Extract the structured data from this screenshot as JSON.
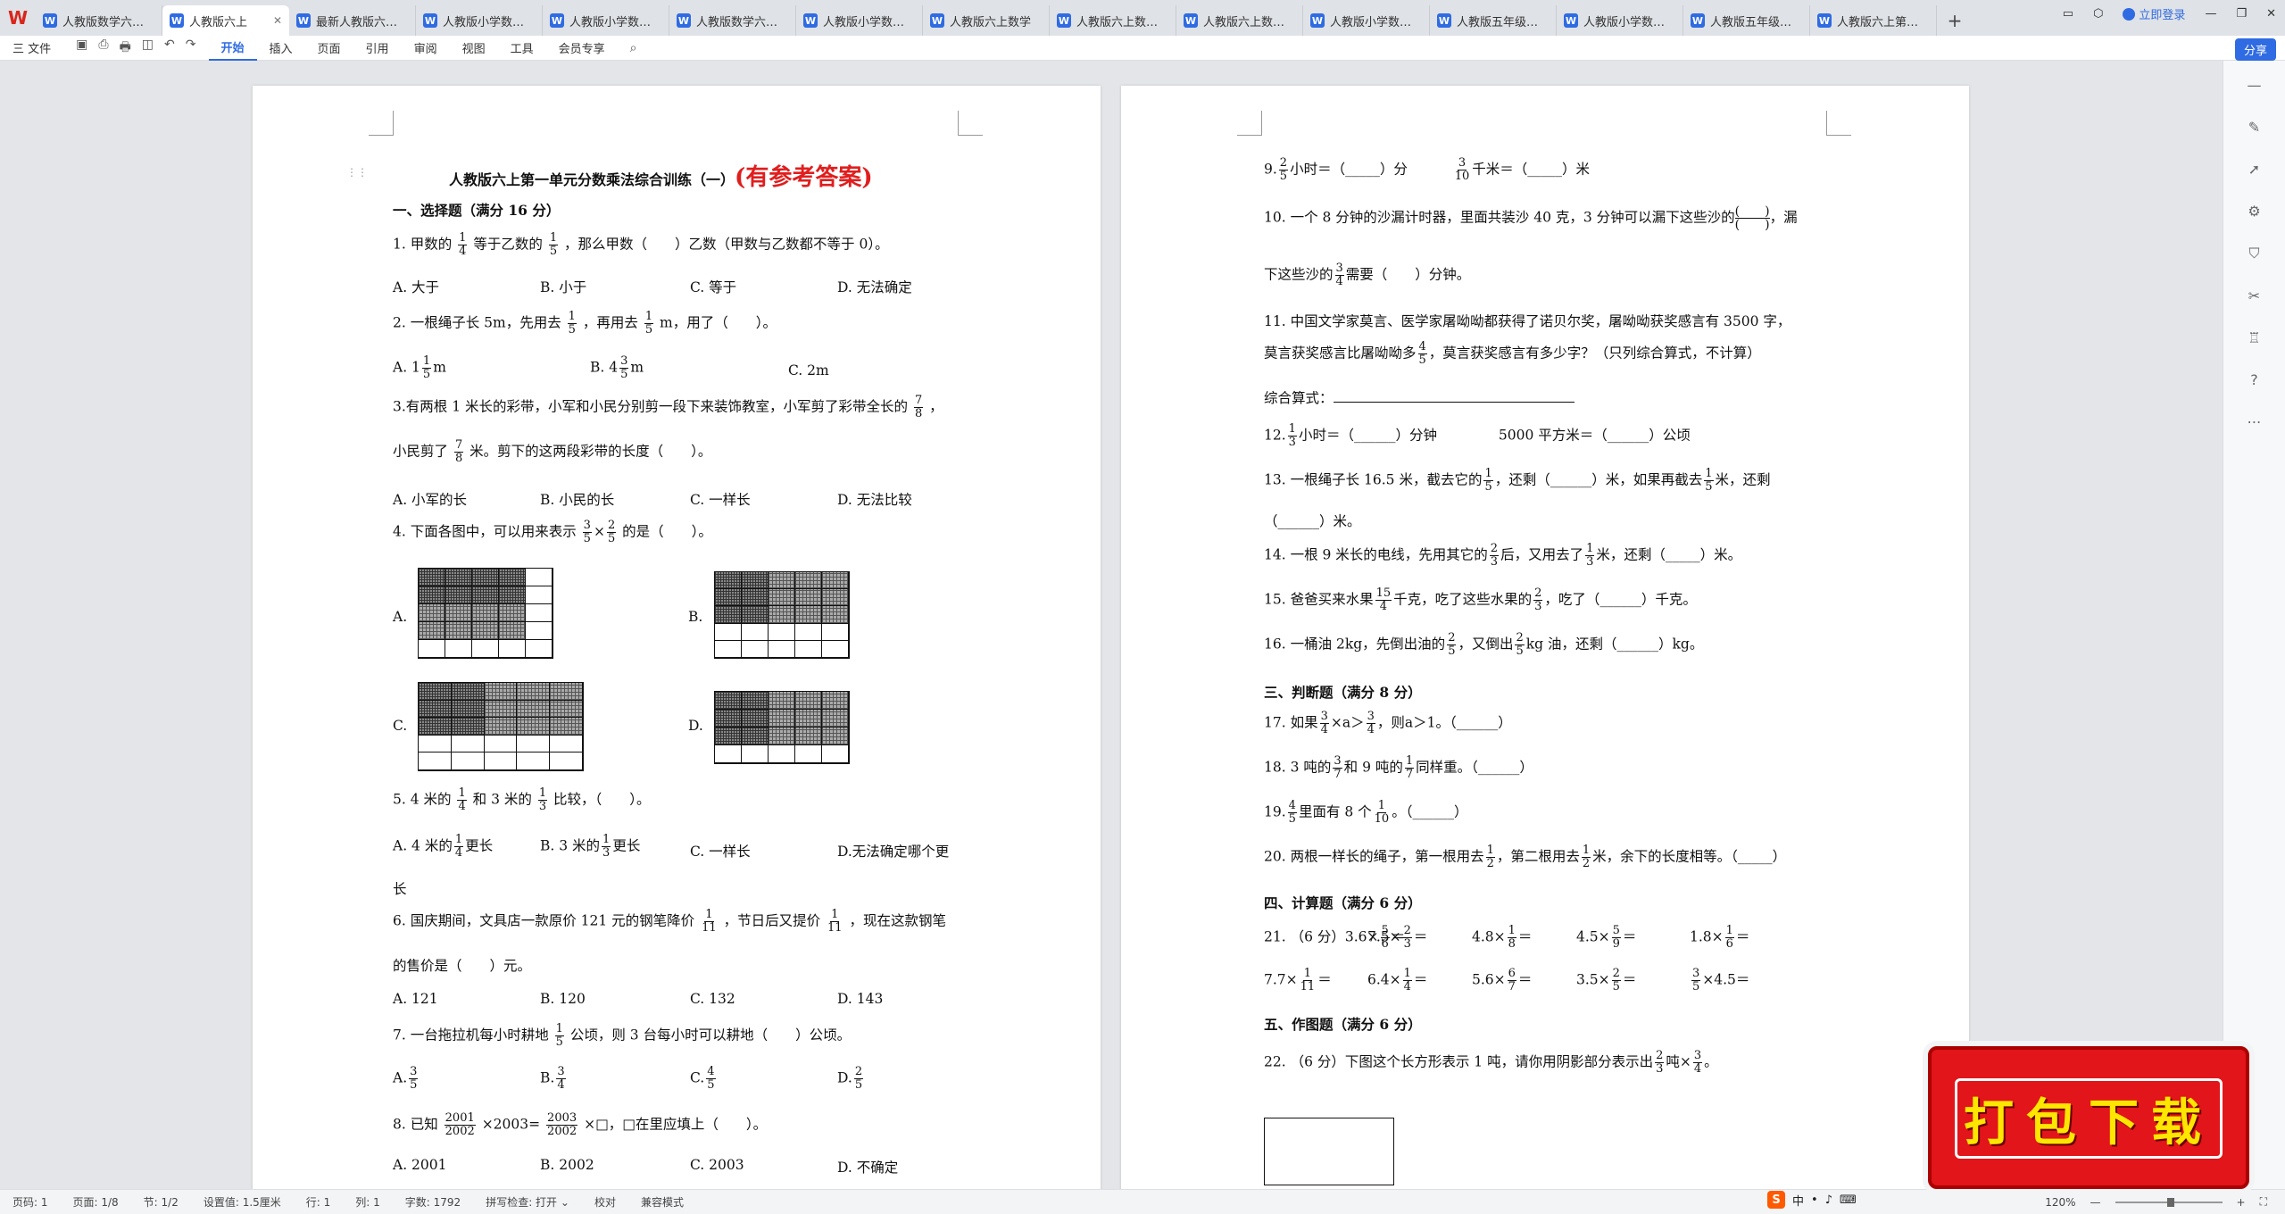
{
  "tabbar": {
    "tabs": [
      {
        "label": "人教版数学六年级"
      },
      {
        "label": "人教版六上",
        "active": true
      },
      {
        "label": "最新人教版六上数"
      },
      {
        "label": "人教版小学数学六"
      },
      {
        "label": "人教版小学数学六"
      },
      {
        "label": "人教版数学六年级"
      },
      {
        "label": "人教版小学数学六"
      },
      {
        "label": "人教版六上数学"
      },
      {
        "label": "人教版六上数学第"
      },
      {
        "label": "人教版六上数学第"
      },
      {
        "label": "人教版小学数学六"
      },
      {
        "label": "人教版五年级上册"
      },
      {
        "label": "人教版小学数学六"
      },
      {
        "label": "人教版五年级上册"
      },
      {
        "label": "人教版六上第一单"
      }
    ],
    "login_label": "立即登录"
  },
  "toolbar": {
    "file_label": "三 文件",
    "items": [
      "开始",
      "插入",
      "页面",
      "引用",
      "审阅",
      "视图",
      "工具",
      "会员专享"
    ],
    "share_label": "分享"
  },
  "page1": {
    "title": "人教版六上第一单元分数乘法综合训练（一）",
    "title_red": "(有参考答案)",
    "sec1": "一、选择题（满分 16 分）",
    "q1_a": "1. 甲数的",
    "q1_f1": {
      "n": "1",
      "d": "4"
    },
    "q1_b": "等于乙数的",
    "q1_f2": {
      "n": "1",
      "d": "5"
    },
    "q1_c": "，那么甲数（　　）乙数（甲数与乙数都不等于 0）。",
    "q1_opts": [
      "A. 大于",
      "B. 小于",
      "C. 等于",
      "D. 无法确定"
    ],
    "q2_a": "2. 一根绳子长 5m，先用去",
    "q2_f1": {
      "n": "1",
      "d": "5"
    },
    "q2_b": "，再用去",
    "q2_f2": {
      "n": "1",
      "d": "5"
    },
    "q2_c": "m，用了（　　）。",
    "q2_opts": [
      {
        "pre": "A. 1",
        "n": "1",
        "d": "5",
        "post": "m"
      },
      {
        "pre": "B. 4",
        "n": "3",
        "d": "5",
        "post": "m"
      },
      {
        "pre": "C. 2m",
        "n": "",
        "d": "",
        "post": ""
      }
    ],
    "q3_a": "3.有两根 1 米长的彩带，小军和小民分别剪一段下来装饰教室，小军剪了彩带全长的",
    "q3_f1": {
      "n": "7",
      "d": "8"
    },
    "q3_b": "，",
    "q3_c": "小民剪了",
    "q3_f2": {
      "n": "7",
      "d": "8"
    },
    "q3_d": "米。剪下的这两段彩带的长度（　　）。",
    "q3_opts": [
      "A. 小军的长",
      "B. 小民的长",
      "C. 一样长",
      "D. 无法比较"
    ],
    "q4_a": "4. 下面各图中，可以用来表示",
    "q4_f1": {
      "n": "3",
      "d": "5"
    },
    "q4_x": "×",
    "q4_f2": {
      "n": "2",
      "d": "5"
    },
    "q4_b": "的是（　　）。",
    "q4_labels": [
      "A.",
      "B.",
      "C.",
      "D."
    ],
    "q5_a": "5. 4 米的",
    "q5_f1": {
      "n": "1",
      "d": "4"
    },
    "q5_b": "和 3 米的",
    "q5_f2": {
      "n": "1",
      "d": "3"
    },
    "q5_c": "比较，（　　）。",
    "q5_optA": "A. 4 米的",
    "q5_optA_f": {
      "n": "1",
      "d": "4"
    },
    "q5_optA_b": "更长",
    "q5_optB": "B. 3 米的",
    "q5_optB_f": {
      "n": "1",
      "d": "3"
    },
    "q5_optB_b": "更长",
    "q5_optC": "C. 一样长",
    "q5_optD": "D.无法确定哪个更",
    "q5_optD2": "长",
    "q6_a": "6. 国庆期间，文具店一款原价 121 元的钢笔降价",
    "q6_f1": {
      "n": "1",
      "d": "11"
    },
    "q6_b": "，节日后又提价",
    "q6_f2": {
      "n": "1",
      "d": "11"
    },
    "q6_c": "，现在这款钢笔",
    "q6_d": "的售价是（　　）元。",
    "q6_opts": [
      "A. 121",
      "B. 120",
      "C. 132",
      "D. 143"
    ],
    "q7_a": "7. 一台拖拉机每小时耕地",
    "q7_f1": {
      "n": "1",
      "d": "5"
    },
    "q7_b": "公顷，则 3 台每小时可以耕地（　　）公顷。",
    "q7_opts": [
      {
        "pre": "A.",
        "n": "3",
        "d": "5"
      },
      {
        "pre": "B.",
        "n": "3",
        "d": "4"
      },
      {
        "pre": "C.",
        "n": "4",
        "d": "5"
      },
      {
        "pre": "D.",
        "n": "2",
        "d": "5"
      }
    ],
    "q8_a": "8. 已知",
    "q8_f1": {
      "n": "2001",
      "d": "2002"
    },
    "q8_b": "×2003=",
    "q8_f2": {
      "n": "2003",
      "d": "2002"
    },
    "q8_c": "×□，□在里应填上（　　）。",
    "q8_opts": [
      "A. 2001",
      "B. 2002",
      "C. 2003",
      "D. 不确定"
    ]
  },
  "page2": {
    "q9_a": "9.",
    "q9_f1": {
      "n": "2",
      "d": "5"
    },
    "q9_b": "小时＝（_____）分",
    "q9_f2": {
      "n": "3",
      "d": "10"
    },
    "q9_c": "千米＝（_____）米",
    "q10_a": "10. 一个 8 分钟的沙漏计时器，里面共装沙 40 克，3 分钟可以漏下这些沙的",
    "q10_p": {
      "n": "(　　)",
      "d": "(　　)"
    },
    "q10_b": "，漏",
    "q10_c": "下这些沙的",
    "q10_f": {
      "n": "3",
      "d": "4"
    },
    "q10_d": "需要（　　）分钟。",
    "q11_a": "11. 中国文学家莫言、医学家屠呦呦都获得了诺贝尔奖，屠呦呦获奖感言有 3500 字，",
    "q11_b": "莫言获奖感言比屠呦呦多",
    "q11_f": {
      "n": "4",
      "d": "5"
    },
    "q11_c": "，莫言获奖感言有多少字？（只列综合算式，不计算）",
    "q11_d": "综合算式：",
    "q12_a": "12.",
    "q12_f": {
      "n": "1",
      "d": "3"
    },
    "q12_b": "小时＝（______）分钟",
    "q12_c": "5000 平方米＝（______）公顷",
    "q13_a": "13. 一根绳子长 16.5 米，截去它的",
    "q13_f1": {
      "n": "1",
      "d": "5"
    },
    "q13_b": "，还剩（______）米，如果再截去",
    "q13_f2": {
      "n": "1",
      "d": "5"
    },
    "q13_c": "米，还剩",
    "q13_d": "（______）米。",
    "q14_a": "14. 一根 9 米长的电线，先用其它的",
    "q14_f1": {
      "n": "2",
      "d": "3"
    },
    "q14_b": "后，又用去了",
    "q14_f2": {
      "n": "1",
      "d": "3"
    },
    "q14_c": "米，还剩（_____）米。",
    "q15_a": "15. 爸爸买来水果",
    "q15_f1": {
      "n": "15",
      "d": "4"
    },
    "q15_b": "千克，吃了这些水果的",
    "q15_f2": {
      "n": "2",
      "d": "3"
    },
    "q15_c": "，吃了（______）千克。",
    "q16_a": "16. 一桶油 2kg，先倒出油的",
    "q16_f1": {
      "n": "2",
      "d": "5"
    },
    "q16_b": "，又倒出",
    "q16_f2": {
      "n": "2",
      "d": "5"
    },
    "q16_c": "kg 油，还剩（______）kg。",
    "sec3": "三、判断题（满分 8 分）",
    "q17_a": "17. 如果",
    "q17_f1": {
      "n": "3",
      "d": "4"
    },
    "q17_b": "×a＞",
    "q17_f2": {
      "n": "3",
      "d": "4"
    },
    "q17_c": "，则a＞1。（______）",
    "q18_a": "18. 3 吨的",
    "q18_f1": {
      "n": "3",
      "d": "7"
    },
    "q18_b": "和 9 吨的",
    "q18_f2": {
      "n": "1",
      "d": "7"
    },
    "q18_c": "同样重。（______）",
    "q19_a": "19.",
    "q19_f1": {
      "n": "4",
      "d": "5"
    },
    "q19_b": "里面有 8 个",
    "q19_f2": {
      "n": "1",
      "d": "10"
    },
    "q19_c": "。（______）",
    "q20_a": "20. 两根一样长的绳子，第一根用去",
    "q20_f1": {
      "n": "1",
      "d": "2"
    },
    "q20_b": "，第二根用去",
    "q20_f2": {
      "n": "1",
      "d": "2"
    },
    "q20_c": "米，余下的长度相等。（_____）",
    "sec4": "四、计算题（满分 6 分）",
    "q21_row1": [
      {
        "pre": "21. （6 分）3.6×",
        "n": "5",
        "d": "6",
        "post": "＝"
      },
      {
        "pre": "7.5×",
        "n": "2",
        "d": "3",
        "post": "＝"
      },
      {
        "pre": "4.8×",
        "n": "1",
        "d": "8",
        "post": "＝"
      },
      {
        "pre": "4.5×",
        "n": "5",
        "d": "9",
        "post": "＝"
      },
      {
        "pre": "1.8×",
        "n": "1",
        "d": "6",
        "post": "＝"
      }
    ],
    "q21_row2": [
      {
        "pre": "7.7×",
        "n": "1",
        "d": "11",
        "post": "＝"
      },
      {
        "pre": "6.4×",
        "n": "1",
        "d": "4",
        "post": "＝"
      },
      {
        "pre": "5.6×",
        "n": "6",
        "d": "7",
        "post": "＝"
      },
      {
        "pre": "3.5×",
        "n": "2",
        "d": "5",
        "post": "＝"
      },
      {
        "pre": "",
        "n": "3",
        "d": "5",
        "post": "×4.5＝"
      }
    ],
    "sec5": "五、作图题（满分 6 分）",
    "q22_a": "22. （6 分）下图这个长方形表示 1 吨，请你用阴影部分表示出",
    "q22_f1": {
      "n": "2",
      "d": "3"
    },
    "q22_b": "吨×",
    "q22_f2": {
      "n": "3",
      "d": "4"
    },
    "q22_c": "。"
  },
  "status": {
    "page_num": "页码: 1",
    "page": "页面: 1/8",
    "section": "节: 1/2",
    "settings": "设置值: 1.5厘米",
    "row": "行: 1",
    "col": "列: 1",
    "words": "字数: 1792",
    "spell": "拼写检查: 打开 ⌄",
    "proof": "校对",
    "compat": "兼容模式",
    "zoom": "120%"
  },
  "banner": {
    "text": "打包下载"
  },
  "ime": {
    "label": "中"
  }
}
